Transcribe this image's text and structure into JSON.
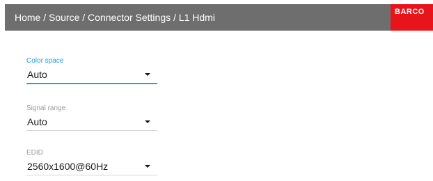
{
  "header": {
    "breadcrumb": "Home / Source / Connector Settings / L1 Hdmi",
    "logo_text": "BARCO",
    "background": "#6e6e6e",
    "logo_color": "#e8141c"
  },
  "fields": [
    {
      "label": "Color space",
      "value": "Auto",
      "active": true
    },
    {
      "label": "Signal range",
      "value": "Auto",
      "active": false
    },
    {
      "label": "EDID",
      "value": "2560x1600@60Hz",
      "active": false
    }
  ],
  "colors": {
    "accent": "#1ba1e2",
    "label": "#9a9a9a",
    "underline": "#d4d4d4"
  },
  "icons": {
    "dropdown": "caret-down-icon",
    "logo": "barco-logo"
  }
}
